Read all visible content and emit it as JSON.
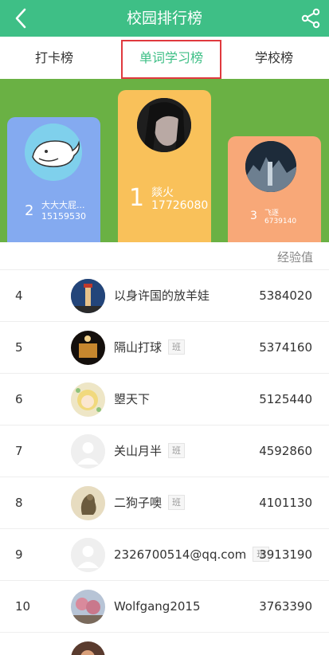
{
  "header": {
    "title": "校园排行榜",
    "back_icon": "chevron-left-icon",
    "share_icon": "share-icon"
  },
  "tabs": [
    {
      "label": "打卡榜",
      "selected": false
    },
    {
      "label": "单词学习榜",
      "selected": true
    },
    {
      "label": "学校榜",
      "selected": false
    }
  ],
  "podium": {
    "first": {
      "rank": "1",
      "name": "燚火",
      "score": "17726080"
    },
    "second": {
      "rank": "2",
      "name": "大大大屁...",
      "score": "15159530"
    },
    "third": {
      "rank": "3",
      "name": "飞逐",
      "score": "6739140"
    }
  },
  "list": {
    "header_label": "经验值",
    "rows": [
      {
        "rank": "4",
        "name": "以身许国的放羊娃",
        "badge": "",
        "score": "5384020"
      },
      {
        "rank": "5",
        "name": "隔山打球",
        "badge": "班",
        "score": "5374160"
      },
      {
        "rank": "6",
        "name": "曌天下",
        "badge": "",
        "score": "5125440"
      },
      {
        "rank": "7",
        "name": "关山月半",
        "badge": "班",
        "score": "4592860"
      },
      {
        "rank": "8",
        "name": "二狗子噢",
        "badge": "班",
        "score": "4101130"
      },
      {
        "rank": "9",
        "name": "2326700514@qq.com",
        "badge": "班",
        "score": "3913190"
      },
      {
        "rank": "10",
        "name": "Wolfgang2015",
        "badge": "",
        "score": "3763390"
      }
    ]
  },
  "colors": {
    "brand_green": "#3ebf86",
    "podium_bg": "#6ab144",
    "highlight_border": "#e0393e"
  }
}
